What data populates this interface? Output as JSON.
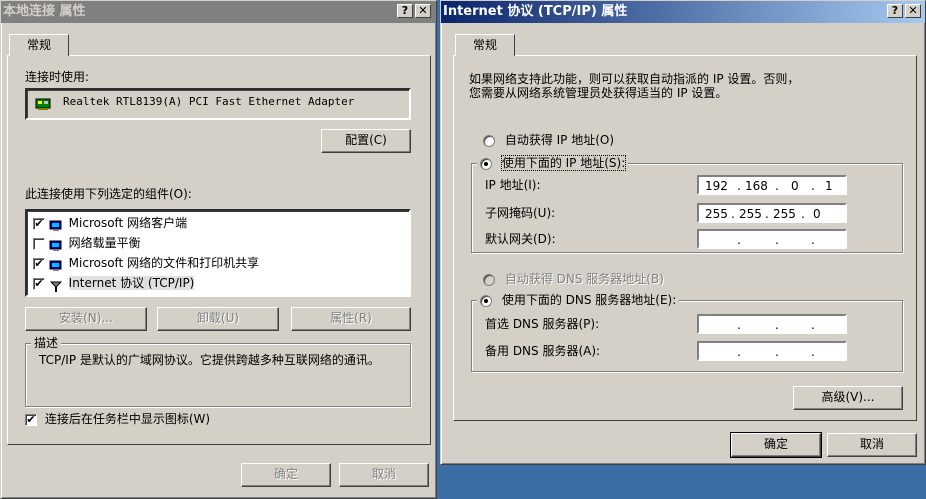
{
  "left_dialog": {
    "title": "本地连接 属性",
    "help_btn": "?",
    "close_btn": "✕",
    "tab": "常规",
    "connect_using_label": "连接时使用:",
    "adapter_name": "Realtek RTL8139(A) PCI Fast Ethernet Adapter",
    "configure_btn": "配置(C)",
    "components_label": "此连接使用下列选定的组件(O):",
    "components": [
      {
        "label": "Microsoft 网络客户端",
        "checked": true,
        "icon": "network-client-icon"
      },
      {
        "label": "网络载量平衡",
        "checked": false,
        "icon": "load-balancing-icon"
      },
      {
        "label": "Microsoft 网络的文件和打印机共享",
        "checked": true,
        "icon": "file-printer-sharing-icon"
      },
      {
        "label": "Internet 协议 (TCP/IP)",
        "checked": true,
        "icon": "protocol-icon"
      }
    ],
    "install_btn": "安装(N)...",
    "uninstall_btn": "卸载(U)",
    "properties_btn": "属性(R)",
    "description_group": "描述",
    "description_text": "TCP/IP 是默认的广域网协议。它提供跨越多种互联网络的通讯。",
    "show_icon_label": "连接后在任务栏中显示图标(W)",
    "show_icon_checked": true,
    "ok_btn": "确定",
    "cancel_btn": "取消"
  },
  "right_dialog": {
    "title": "Internet 协议 (TCP/IP) 属性",
    "help_btn": "?",
    "close_btn": "✕",
    "tab": "常规",
    "intro_line1": "如果网络支持此功能，则可以获取自动指派的 IP 设置。否则，",
    "intro_line2": "您需要从网络系统管理员处获得适当的 IP 设置。",
    "auto_ip_label": "自动获得 IP 地址(O)",
    "manual_ip_label": "使用下面的 IP 地址(S):",
    "ip_address_label": "IP 地址(I):",
    "ip_address": [
      "192",
      "168",
      "0",
      "1"
    ],
    "subnet_label": "子网掩码(U):",
    "subnet": [
      "255",
      "255",
      "255",
      "0"
    ],
    "gateway_label": "默认网关(D):",
    "gateway": [
      "",
      "",
      "",
      ""
    ],
    "auto_dns_label": "自动获得 DNS 服务器地址(B)",
    "manual_dns_label": "使用下面的 DNS 服务器地址(E):",
    "preferred_dns_label": "首选 DNS 服务器(P):",
    "preferred_dns": [
      "",
      "",
      "",
      ""
    ],
    "alternate_dns_label": "备用 DNS 服务器(A):",
    "alternate_dns": [
      "",
      "",
      "",
      ""
    ],
    "advanced_btn": "高级(V)...",
    "ok_btn": "确定",
    "cancel_btn": "取消",
    "ip_mode": "manual",
    "dns_mode": "manual"
  },
  "colors": {
    "desktop": "#3a6ea5",
    "dialog_face": "#d4d0c8",
    "active_title_start": "#0a246a",
    "active_title_end": "#a6caf0",
    "inactive_title": "#808080"
  }
}
